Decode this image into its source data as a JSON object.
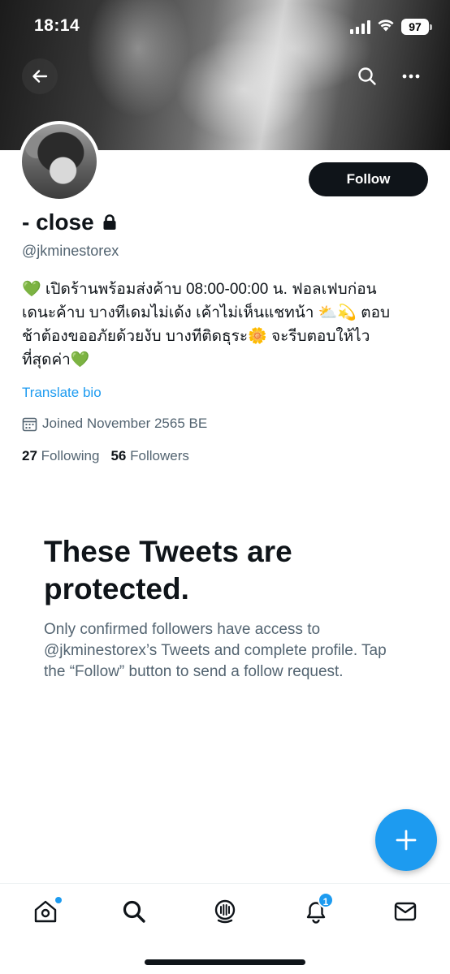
{
  "status_bar": {
    "time": "18:14",
    "battery": "97"
  },
  "header": {
    "back_icon": "arrow-left-icon",
    "search_icon": "search-icon",
    "more_icon": "more-horizontal-icon"
  },
  "profile": {
    "display_name": "- close",
    "lock_icon": "lock-icon",
    "handle": "@jkminestorex",
    "follow_label": "Follow",
    "bio": {
      "line1": "💚 เปิดร้านพร้อมส่งค้าบ 08:00-00:00 น. ฟอลเฟบก่อน",
      "line2": "เดนะค้าบ บางทีเดมไม่เด้ง เค้าไม่เห็นแชทน้า ⛅💫 ตอบ",
      "line3": "ช้าต้องขออภัยด้วยงับ บางทีติดธุระ🌼 จะรีบตอบให้ไว",
      "line4": "ที่สุดค่า💚"
    },
    "translate_label": "Translate bio",
    "joined": "Joined November 2565 BE",
    "following_count": "27",
    "following_label": "Following",
    "followers_count": "56",
    "followers_label": "Followers"
  },
  "protected": {
    "title": "These Tweets are protected.",
    "text": "Only confirmed followers have access to @jkminestorex’s Tweets and complete profile. Tap the “Follow” button to send a follow request."
  },
  "fab": {
    "icon": "plus-icon"
  },
  "tabbar": {
    "items": [
      {
        "icon": "home-icon"
      },
      {
        "icon": "search-icon"
      },
      {
        "icon": "spaces-icon"
      },
      {
        "icon": "notifications-icon",
        "badge": "1"
      },
      {
        "icon": "messages-icon"
      }
    ]
  },
  "colors": {
    "accent": "#1d9bf0",
    "text_primary": "#0f1419",
    "text_secondary": "#536471"
  }
}
